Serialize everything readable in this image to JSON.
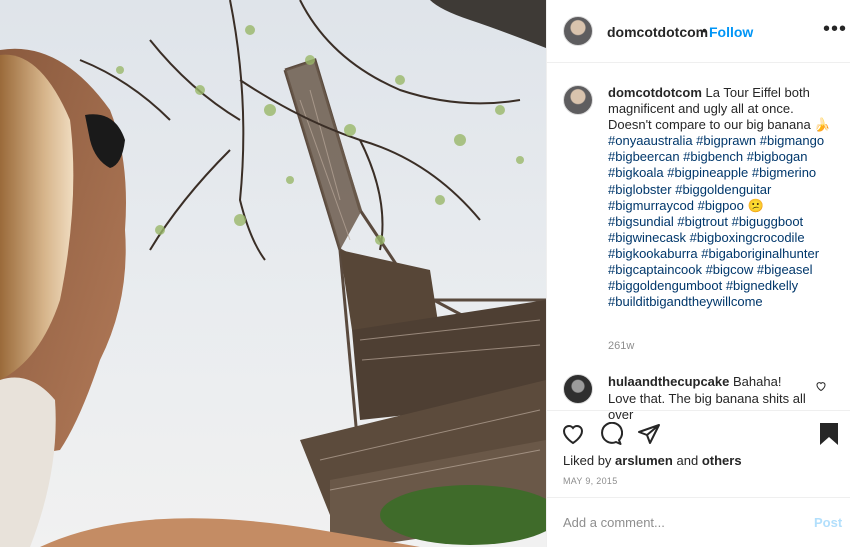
{
  "photo": {
    "alt": "Woman looking up at the Eiffel Tower through tree branches"
  },
  "header": {
    "username": "domcotdotcom",
    "separator": "•",
    "follow_label": "Follow",
    "more_icon": "ellipsis-icon"
  },
  "caption": {
    "username": "domcotdotcom",
    "text": "La Tour Eiffel both magnificent and ugly all at once. Doesn't compare to our big banana",
    "emoji1": "🍌",
    "tags1": "#onyaaustralia #bigprawn #bigmango #bigbeercan #bigbench #bigbogan #bigkoala #bigpineapple #bigmerino #biglobster #biggoldenguitar #bigmurraycod #bigpoo",
    "emoji2": "😕",
    "tags2": "#bigsundial #bigtrout #biguggboot #bigwinecask #bigboxingcrocodile #bigkookaburra #bigaboriginalhunter #bigcaptaincook #bigcow #bigeasel #biggoldengumboot #bignedkelly #builditbigandtheywillcome",
    "time": "261w"
  },
  "comment": {
    "username": "hulaandthecupcake",
    "text": "Bahaha! Love that. The big banana shits all over"
  },
  "actions": {
    "liked_prefix": "Liked by",
    "liked_user": "arslumen",
    "liked_and": "and",
    "liked_others": "others",
    "date": "MAY 9, 2015"
  },
  "input": {
    "placeholder": "Add a comment...",
    "post_label": "Post"
  }
}
